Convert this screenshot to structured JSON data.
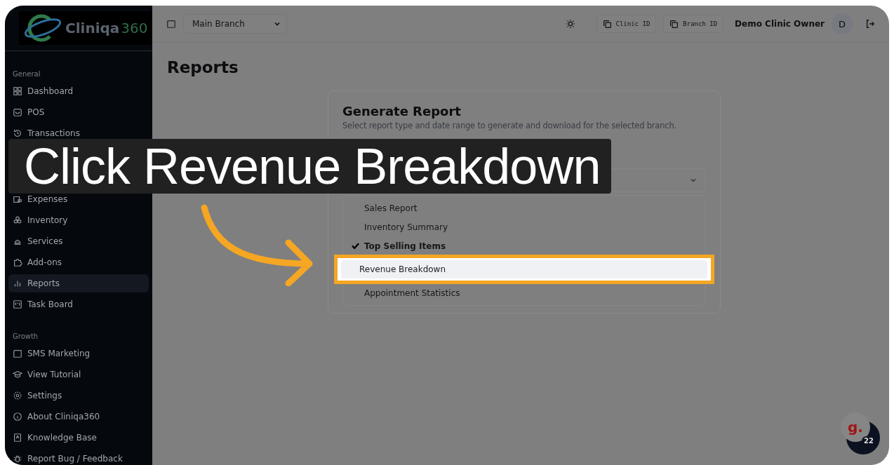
{
  "logo": {
    "name": "Cliniqa",
    "suffix": "360"
  },
  "sidebar": {
    "sections": [
      {
        "title": "General",
        "items": [
          {
            "label": "Dashboard",
            "selected": false
          },
          {
            "label": "POS",
            "selected": false
          },
          {
            "label": "Transactions",
            "selected": false
          },
          {
            "label": "Expenses",
            "selected": false,
            "after_gap": true
          },
          {
            "label": "Inventory",
            "selected": false
          },
          {
            "label": "Services",
            "selected": false
          },
          {
            "label": "Add-ons",
            "selected": false
          },
          {
            "label": "Reports",
            "selected": true
          },
          {
            "label": "Task Board",
            "selected": false
          }
        ]
      },
      {
        "title": "Growth",
        "items": [
          {
            "label": "SMS Marketing",
            "selected": false
          }
        ]
      }
    ],
    "footer": [
      {
        "label": "View Tutorial"
      },
      {
        "label": "Settings"
      },
      {
        "label": "About Cliniqa360"
      },
      {
        "label": "Knowledge Base"
      },
      {
        "label": "Report Bug / Feedback"
      }
    ]
  },
  "topbar": {
    "branch": "Main Branch",
    "buttons": [
      "Clinic ID",
      "Branch ID"
    ],
    "user": "Demo Clinic Owner",
    "avatar": "D"
  },
  "page": {
    "title": "Reports"
  },
  "card": {
    "title": "Generate Report",
    "subtitle": "Select report type and date range to generate and download for the selected branch.",
    "options": [
      {
        "label": "Sales Report",
        "selected": false,
        "highlighted": false
      },
      {
        "label": "Inventory Summary",
        "selected": false,
        "highlighted": false
      },
      {
        "label": "Top Selling Items",
        "selected": true,
        "highlighted": false
      },
      {
        "label": "Revenue Breakdown",
        "selected": false,
        "highlighted": true
      },
      {
        "label": "Appointment Statistics",
        "selected": false,
        "highlighted": false
      }
    ]
  },
  "guide": {
    "caption": "Click Revenue Breakdown"
  },
  "chat_badge": {
    "letter": "g.",
    "count": "22"
  }
}
